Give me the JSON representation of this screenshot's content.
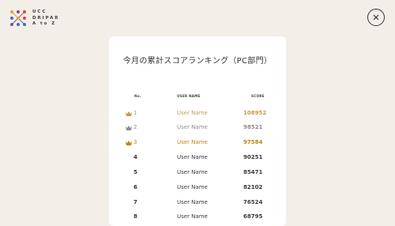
{
  "logo": {
    "lines": [
      "UCC",
      "DRIPAR",
      "A to Z"
    ]
  },
  "colors": {
    "background": "#f3eee8",
    "card": "#ffffff",
    "gold": "#c49a52",
    "silver": "#8d8d8d",
    "bronze": "#c0860d"
  },
  "panel": {
    "title": "今月の累計スコアランキング（PC部門）",
    "columns": {
      "no": "No.",
      "user": "USER NAME",
      "score": "SCORE"
    },
    "rows": [
      {
        "rank": "1",
        "user": "User Name",
        "score": "108952",
        "icon": "crown-icon"
      },
      {
        "rank": "2",
        "user": "User Name",
        "score": "98521",
        "icon": "crown-icon"
      },
      {
        "rank": "3",
        "user": "User Name",
        "score": "97584",
        "icon": "crown-icon"
      },
      {
        "rank": "4",
        "user": "User Name",
        "score": "90251"
      },
      {
        "rank": "5",
        "user": "User Name",
        "score": "85471"
      },
      {
        "rank": "6",
        "user": "User Name",
        "score": "82102"
      },
      {
        "rank": "7",
        "user": "User Name",
        "score": "76524"
      },
      {
        "rank": "8",
        "user": "User Name",
        "score": "68795"
      }
    ]
  },
  "close": {
    "icon": "close-icon"
  }
}
